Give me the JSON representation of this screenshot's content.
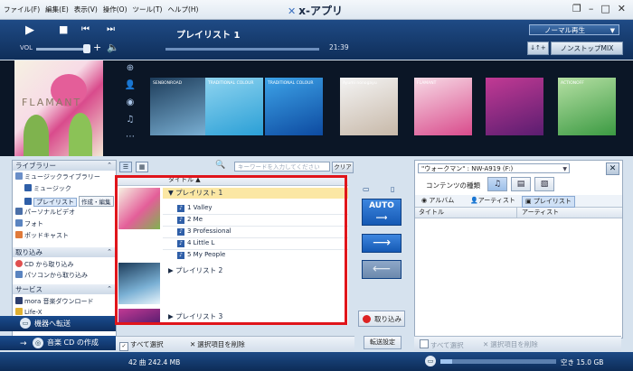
{
  "app": {
    "title": "x-アプリ",
    "menu": [
      "ファイル(F)",
      "編集(E)",
      "表示(V)",
      "操作(O)",
      "ツール(T)",
      "ヘルプ(H)"
    ]
  },
  "player": {
    "now_playing": "プレイリスト 1",
    "time": "21:39",
    "volume_label": "VOL",
    "mode": "ノーマル再生",
    "nonstop": "ノンストップMIX",
    "shuffle_label": "↓↑+"
  },
  "artwork": {
    "big_cover_text": "FLAMANT",
    "thumbs": [
      {
        "caption": "SENBONROAD",
        "colors": [
          "#1d3c5a",
          "#7ab0d4"
        ]
      },
      {
        "caption": "TRADITIONAL COLOUR",
        "colors": [
          "#8fd4f0",
          "#2a9fd6"
        ]
      },
      {
        "caption": "TRADITIONAL COLOUR",
        "colors": [
          "#3da3e8",
          "#0d4aa0"
        ]
      },
      {
        "caption": "Ayumi nonogayu",
        "colors": [
          "#f4f4f4",
          "#c7b8a8"
        ]
      },
      {
        "caption": "FLAMANT",
        "colors": [
          "#f7dbe6",
          "#d94b8c"
        ]
      },
      {
        "caption": "",
        "colors": [
          "#c23a94",
          "#5a1d70"
        ]
      },
      {
        "caption": "ACTIONOFF",
        "colors": [
          "#b6e0a4",
          "#3b9a42"
        ]
      }
    ]
  },
  "library": {
    "header": "ライブラリー",
    "items": [
      {
        "label": "ミュージックライブラリー",
        "indent": 0
      },
      {
        "label": "ミュージック",
        "indent": 1
      },
      {
        "label": "プレイリスト",
        "indent": 1,
        "selected": true,
        "tag": "作成・編集"
      },
      {
        "label": "パーソナルビデオ",
        "indent": 0
      },
      {
        "label": "フォト",
        "indent": 0
      },
      {
        "label": "ポッドキャスト",
        "indent": 0
      }
    ],
    "import_header": "取り込み",
    "import_items": [
      "CD から取り込み",
      "パソコンから取り込み"
    ],
    "service_header": "サービス",
    "service_items": [
      "mora 音楽ダウンロード",
      "Life-X"
    ],
    "transfer_button": "機器へ転送",
    "cd_button": "音楽 CD の作成"
  },
  "center": {
    "search_placeholder": "キーワードを入力してください",
    "clear": "クリア",
    "col_title": "タイトル",
    "playlists": [
      {
        "name": "プレイリスト 1",
        "tracks": [
          "1 Valley",
          "2 Me",
          "3 Professional",
          "4 Little L",
          "5 My People"
        ]
      },
      {
        "name": "プレイリスト 2",
        "tracks": []
      },
      {
        "name": "プレイリスト 3",
        "tracks": []
      }
    ],
    "select_all": "すべて選択",
    "delete_selected": "選択項目を削除"
  },
  "middle": {
    "auto": "AUTO",
    "import": "取り込み",
    "transfer_settings": "転送設定"
  },
  "device": {
    "name": "\"ウォークマン\" : NW-A919 (F:)",
    "content_type": "コンテンツの種類",
    "tabs": [
      "アルバム",
      "アーティスト",
      "プレイリスト"
    ],
    "col_title": "タイトル",
    "col_artist": "アーティスト",
    "select_all": "すべて選択",
    "delete_selected": "選択項目を削除"
  },
  "status": {
    "left": "42 曲  242.4 MB",
    "right": "空き 15.0 GB",
    "capacity_used_fraction": 0.1
  }
}
